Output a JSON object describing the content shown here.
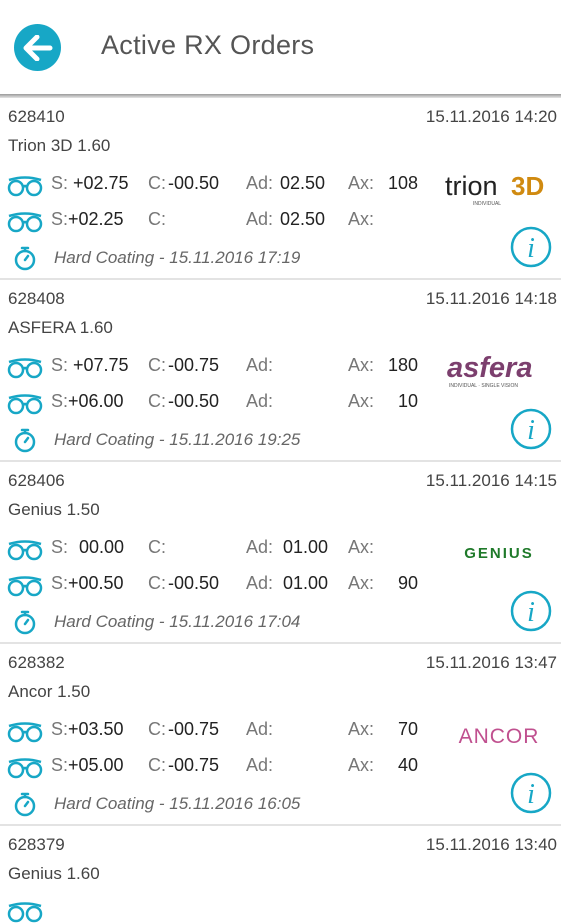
{
  "header": {
    "title": "Active RX Orders"
  },
  "orders": [
    {
      "id": "628410",
      "date": "15.11.2016 14:20",
      "product": "Trion 3D 1.60",
      "right": {
        "s": "+02.75",
        "c": "-00.50",
        "ad": "02.50",
        "ax": "108"
      },
      "left": {
        "s": "+02.25",
        "c": "",
        "ad": "02.50",
        "ax": ""
      },
      "coating": "Hard Coating - 15.11.2016 17:19",
      "brand": "trion3D",
      "brand_sub": "INDIVIDUAL"
    },
    {
      "id": "628408",
      "date": "15.11.2016 14:18",
      "product": "ASFERA 1.60",
      "right": {
        "s": "+07.75",
        "c": "-00.75",
        "ad": "",
        "ax": "180"
      },
      "left": {
        "s": "+06.00",
        "c": "-00.50",
        "ad": "",
        "ax": "10"
      },
      "coating": "Hard Coating - 15.11.2016 19:25",
      "brand": "asfera",
      "brand_sub": "INDIVIDUAL · SINGLE VISION"
    },
    {
      "id": "628406",
      "date": "15.11.2016 14:15",
      "product": "Genius 1.50",
      "right": {
        "s": "00.00",
        "c": "",
        "ad": "01.00",
        "ax": ""
      },
      "left": {
        "s": "+00.50",
        "c": "-00.50",
        "ad": "01.00",
        "ax": "90"
      },
      "coating": "Hard Coating - 15.11.2016 17:04",
      "brand": "GENIUS",
      "brand_sub": ""
    },
    {
      "id": "628382",
      "date": "15.11.2016 13:47",
      "product": "Ancor 1.50",
      "right": {
        "s": "+03.50",
        "c": "-00.75",
        "ad": "",
        "ax": "70"
      },
      "left": {
        "s": "+05.00",
        "c": "-00.75",
        "ad": "",
        "ax": "40"
      },
      "coating": "Hard Coating - 15.11.2016 16:05",
      "brand": "ANCOR",
      "brand_sub": ""
    },
    {
      "id": "628379",
      "date": "15.11.2016 13:40",
      "product": "Genius 1.60"
    }
  ],
  "labels": {
    "s": "S:",
    "c": "C:",
    "ad": "Ad:",
    "ax": "Ax:"
  },
  "icons": {
    "back": "arrow-left-icon",
    "glasses": "glasses-icon",
    "timer": "stopwatch-icon",
    "info": "info-icon"
  },
  "colors": {
    "accent": "#17a7c6",
    "asfera": "#7c3f6e",
    "genius": "#1f7a2a",
    "ancor": "#c0508f",
    "trion3d": "#d08a10"
  }
}
